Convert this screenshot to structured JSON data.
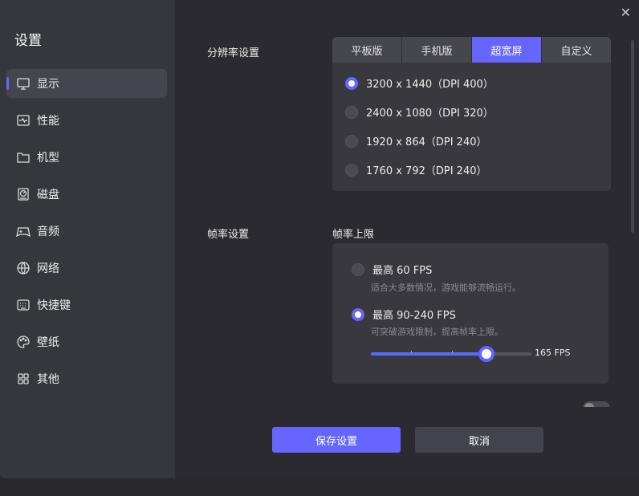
{
  "sidebar": {
    "title": "设置",
    "items": [
      {
        "label": "显示",
        "icon": "monitor-icon"
      },
      {
        "label": "性能",
        "icon": "performance-icon"
      },
      {
        "label": "机型",
        "icon": "folder-icon"
      },
      {
        "label": "磁盘",
        "icon": "disk-icon"
      },
      {
        "label": "音频",
        "icon": "gamepad-icon"
      },
      {
        "label": "网络",
        "icon": "globe-icon"
      },
      {
        "label": "快捷键",
        "icon": "keyboard-icon"
      },
      {
        "label": "壁纸",
        "icon": "palette-icon"
      },
      {
        "label": "其他",
        "icon": "grid-icon"
      }
    ],
    "active": 0
  },
  "resolution": {
    "label": "分辨率设置",
    "tabs": [
      "平板版",
      "手机版",
      "超宽屏",
      "自定义"
    ],
    "active_tab": 2,
    "options": [
      "3200 x 1440（DPI 400）",
      "2400 x 1080（DPI 320）",
      "1920 x 864（DPI 240）",
      "1760 x 792（DPI 240）"
    ],
    "selected": 0
  },
  "framerate": {
    "label": "帧率设置",
    "sublabel": "帧率上限",
    "options": [
      {
        "title": "最高 60 FPS",
        "desc": "适合大多数情况，游戏能够流畅运行。"
      },
      {
        "title": "最高 90-240 FPS",
        "desc": "可突破游戏限制，提高帧率上限。"
      }
    ],
    "selected": 1,
    "slider": {
      "value_label": "165 FPS",
      "value": 165,
      "fraction": 0.72
    }
  },
  "footer": {
    "save": "保存设置",
    "cancel": "取消"
  },
  "colors": {
    "accent": "#6666ff"
  }
}
